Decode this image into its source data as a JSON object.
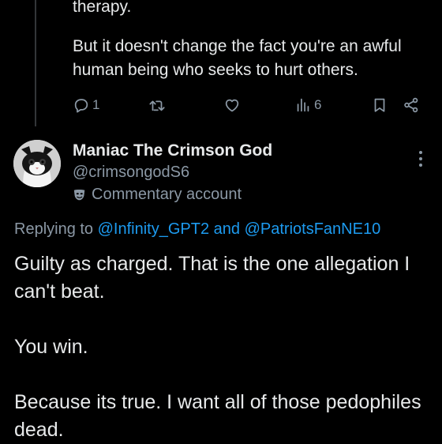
{
  "parent_tweet": {
    "text_line1": "therapy.",
    "text_line2": "But it doesn't change the fact you're an awful human being who seeks to hurt others.",
    "actions": {
      "reply_count": "1",
      "retweet_count": "",
      "like_count": "",
      "views_count": "6"
    },
    "icons": [
      "reply-icon",
      "retweet-icon",
      "like-icon",
      "views-icon",
      "bookmark-icon",
      "share-icon"
    ]
  },
  "tweet": {
    "author_name": "Maniac The Crimson God",
    "handle": "@crimsongodS6",
    "account_label": "Commentary account",
    "replying_prefix": "Replying to",
    "replying_user1": "@Infinity_GPT2",
    "replying_conj": "and",
    "replying_user2": "@PatriotsFanNE10",
    "body_para1": "Guilty as charged. That is the one allegation I can't beat.",
    "body_para2": "You win.",
    "body_para3": "Because its true. I want all of those pedophiles dead."
  },
  "colors": {
    "background": "#000000",
    "text": "#e7e9ea",
    "secondary": "#8b98a5",
    "link": "#1d9bf0"
  }
}
